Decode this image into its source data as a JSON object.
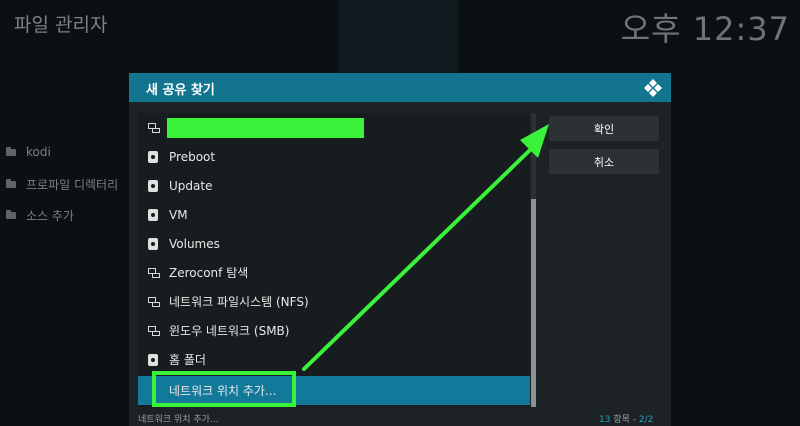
{
  "header": {
    "title": "파일 관리자",
    "clock": "오후 12:37"
  },
  "sidebar": {
    "items": [
      {
        "label": "kodi",
        "icon": "folder-icon"
      },
      {
        "label": "프로파일 디렉터리",
        "icon": "folder-icon"
      },
      {
        "label": "소스 추가",
        "icon": "folder-icon"
      }
    ]
  },
  "dialog": {
    "title": "새 공유 찾기",
    "logo": "kodi-logo-icon",
    "items": [
      {
        "label": "",
        "icon": "network-icon",
        "redacted": true
      },
      {
        "label": "Preboot",
        "icon": "drive-icon"
      },
      {
        "label": "Update",
        "icon": "drive-icon"
      },
      {
        "label": "VM",
        "icon": "drive-icon"
      },
      {
        "label": "Volumes",
        "icon": "drive-icon"
      },
      {
        "label": "Zeroconf 탐색",
        "icon": "network-icon"
      },
      {
        "label": "네트워크 파일시스템 (NFS)",
        "icon": "network-icon"
      },
      {
        "label": "윈도우 네트워크 (SMB)",
        "icon": "network-icon"
      },
      {
        "label": "홈 폴더",
        "icon": "drive-icon"
      },
      {
        "label": "네트워크 위치 추가...",
        "icon": "none",
        "selected": true
      }
    ],
    "buttons": {
      "ok": "확인",
      "cancel": "취소"
    },
    "footer": {
      "selected_label": "네트워크 위치 추가...",
      "count": "13",
      "items_label": "항목",
      "page": "2/2"
    }
  },
  "colors": {
    "header_bar": "#12748e",
    "selection": "#12799a",
    "annotation_green": "#3af23a",
    "accent_blue": "#1f9fd0"
  }
}
